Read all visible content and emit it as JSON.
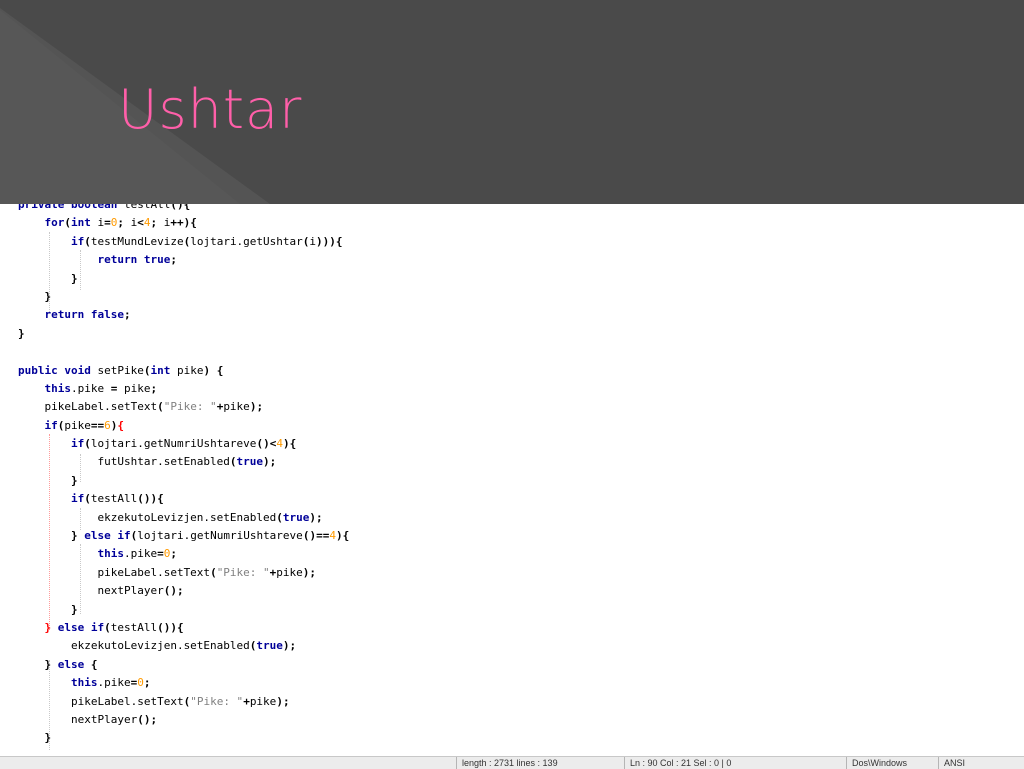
{
  "slide": {
    "title": "Ushtar"
  },
  "code_lines": [
    "private boolean testAll(){",
    "    for(int i=0; i<4; i++){",
    "        if(testMundLevize(lojtari.getUshtar(i))){",
    "            return true;",
    "        }",
    "    }",
    "    return false;",
    "}",
    "",
    "public void setPike(int pike) {",
    "    this.pike = pike;",
    "    pikeLabel.setText(\"Pike: \"+pike);",
    "    if(pike==6){",
    "        if(lojtari.getNumriUshtareve()<4){",
    "            futUshtar.setEnabled(true);",
    "        }",
    "        if(testAll()){",
    "            ekzekutoLevizjen.setEnabled(true);",
    "        } else if(lojtari.getNumriUshtareve()==4){",
    "            this.pike=0;",
    "            pikeLabel.setText(\"Pike: \"+pike);",
    "            nextPlayer();",
    "        }",
    "    } else if(testAll()){",
    "        ekzekutoLevizjen.setEnabled(true);",
    "    } else {",
    "        this.pike=0;",
    "        pikeLabel.setText(\"Pike: \"+pike);",
    "        nextPlayer();",
    "    }"
  ],
  "status_bar": {
    "length": "length : 2731   lines : 139",
    "position": "Ln : 90   Col : 21   Sel : 0 | 0",
    "eol": "Dos\\Windows",
    "encoding": "ANSI"
  }
}
